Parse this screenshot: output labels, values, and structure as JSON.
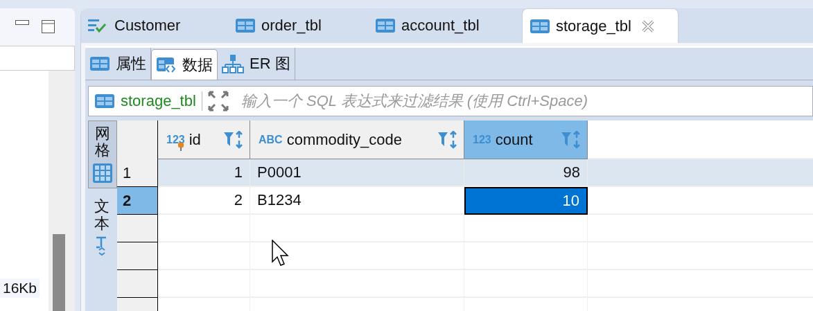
{
  "side_panel": {
    "size_label": "16Kb"
  },
  "editor_tabs": [
    {
      "label": "Customer",
      "kind": "script",
      "selected": false
    },
    {
      "label": "order_tbl",
      "kind": "table",
      "selected": false
    },
    {
      "label": "account_tbl",
      "kind": "table",
      "selected": false
    },
    {
      "label": "storage_tbl",
      "kind": "table",
      "selected": true
    }
  ],
  "sub_tabs": [
    {
      "label": "属性",
      "kind": "table",
      "selected": false
    },
    {
      "label": "数据",
      "kind": "data",
      "selected": true
    },
    {
      "label": "ER 图",
      "kind": "er",
      "selected": false
    }
  ],
  "filter": {
    "table_name": "storage_tbl",
    "placeholder": "输入一个 SQL 表达式来过滤结果 (使用 Ctrl+Space)"
  },
  "view_tabs": [
    {
      "label": "网格",
      "kind": "grid",
      "selected": true
    },
    {
      "label": "文本",
      "kind": "text",
      "selected": false
    }
  ],
  "table": {
    "columns": [
      {
        "name": "id",
        "type_label": "123",
        "key": true,
        "selected": false
      },
      {
        "name": "commodity_code",
        "type_label": "ABC",
        "key": false,
        "selected": false
      },
      {
        "name": "count",
        "type_label": "123",
        "key": false,
        "selected": true
      }
    ],
    "rows": [
      {
        "number": "1",
        "selected": false,
        "current": true,
        "cells": [
          {
            "text": "1",
            "focused": false
          },
          {
            "text": "P0001",
            "focused": false
          },
          {
            "text": "98",
            "focused": false
          }
        ]
      },
      {
        "number": "2",
        "selected": true,
        "current": false,
        "cells": [
          {
            "text": "2",
            "focused": false
          },
          {
            "text": "B1234",
            "focused": false
          },
          {
            "text": "10",
            "focused": true
          }
        ]
      }
    ]
  }
}
